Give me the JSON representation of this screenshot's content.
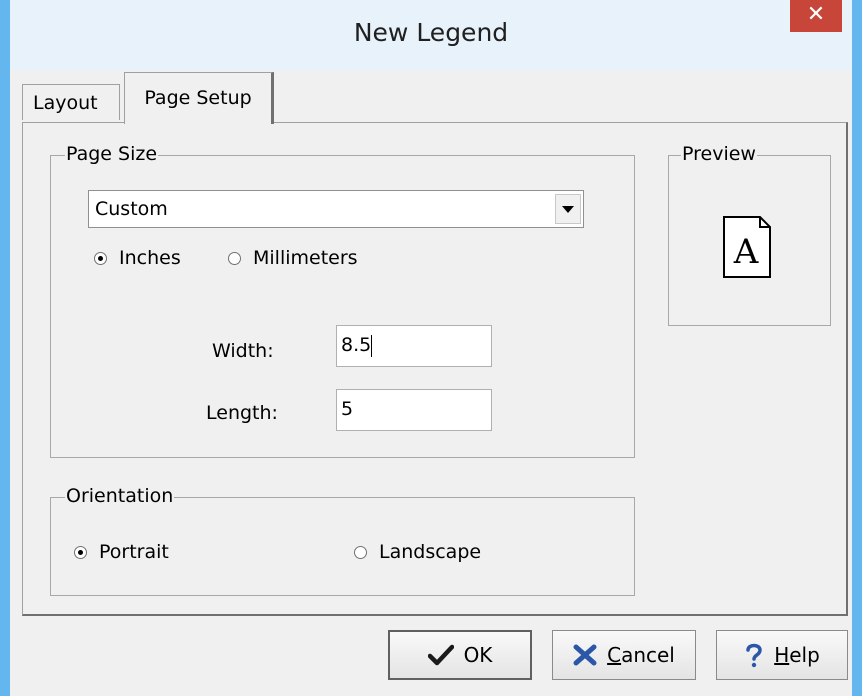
{
  "window": {
    "title": "New Legend",
    "close_glyph": "✕"
  },
  "tabs": [
    {
      "label": "Layout",
      "active": false
    },
    {
      "label": "Page Setup",
      "active": true
    }
  ],
  "page_size": {
    "group_label": "Page Size",
    "selected": "Custom",
    "units": [
      {
        "label": "Inches",
        "checked": true
      },
      {
        "label": "Millimeters",
        "checked": false
      }
    ],
    "width_label": "Width:",
    "width_value": "8.5",
    "length_label": "Length:",
    "length_value": "5"
  },
  "preview": {
    "group_label": "Preview",
    "icon": "page-letter-icon",
    "icon_letter": "A"
  },
  "orientation": {
    "group_label": "Orientation",
    "options": [
      {
        "label": "Portrait",
        "checked": true
      },
      {
        "label": "Landscape",
        "checked": false
      }
    ]
  },
  "buttons": {
    "ok": {
      "label": "OK",
      "icon": "checkmark-icon"
    },
    "cancel": {
      "accel": "C",
      "rest": "ancel",
      "icon": "x-icon",
      "icon_color": "#2a57a8"
    },
    "help": {
      "accel": "H",
      "rest": "elp",
      "icon": "question-icon",
      "icon_color": "#2a57a8"
    }
  },
  "colors": {
    "title_frame": "#64b6ee",
    "close_button": "#c8453a"
  }
}
